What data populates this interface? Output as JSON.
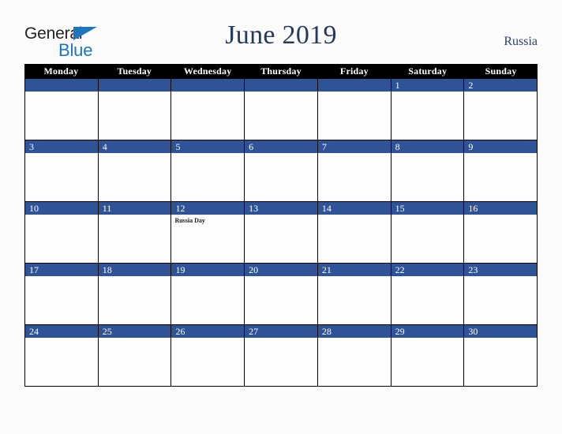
{
  "brand": {
    "word_one": "General",
    "word_two": "Blue",
    "triangle_icon": "triangle-icon",
    "dark_color": "#231f20",
    "blue_color": "#1e76bd"
  },
  "header": {
    "title": "June 2019",
    "country": "Russia",
    "title_color": "#27385e"
  },
  "theme": {
    "accent_blue": "#2e5396",
    "header_black": "#000000",
    "page_background": "#fcfcfd",
    "cell_background": "#fdfdfe"
  },
  "weekdays": [
    "Monday",
    "Tuesday",
    "Wednesday",
    "Thursday",
    "Friday",
    "Saturday",
    "Sunday"
  ],
  "weeks": [
    [
      {
        "day": "",
        "event": ""
      },
      {
        "day": "",
        "event": ""
      },
      {
        "day": "",
        "event": ""
      },
      {
        "day": "",
        "event": ""
      },
      {
        "day": "",
        "event": ""
      },
      {
        "day": "1",
        "event": ""
      },
      {
        "day": "2",
        "event": ""
      }
    ],
    [
      {
        "day": "3",
        "event": ""
      },
      {
        "day": "4",
        "event": ""
      },
      {
        "day": "5",
        "event": ""
      },
      {
        "day": "6",
        "event": ""
      },
      {
        "day": "7",
        "event": ""
      },
      {
        "day": "8",
        "event": ""
      },
      {
        "day": "9",
        "event": ""
      }
    ],
    [
      {
        "day": "10",
        "event": ""
      },
      {
        "day": "11",
        "event": ""
      },
      {
        "day": "12",
        "event": "Russia Day"
      },
      {
        "day": "13",
        "event": ""
      },
      {
        "day": "14",
        "event": ""
      },
      {
        "day": "15",
        "event": ""
      },
      {
        "day": "16",
        "event": ""
      }
    ],
    [
      {
        "day": "17",
        "event": ""
      },
      {
        "day": "18",
        "event": ""
      },
      {
        "day": "19",
        "event": ""
      },
      {
        "day": "20",
        "event": ""
      },
      {
        "day": "21",
        "event": ""
      },
      {
        "day": "22",
        "event": ""
      },
      {
        "day": "23",
        "event": ""
      }
    ],
    [
      {
        "day": "24",
        "event": ""
      },
      {
        "day": "25",
        "event": ""
      },
      {
        "day": "26",
        "event": ""
      },
      {
        "day": "27",
        "event": ""
      },
      {
        "day": "28",
        "event": ""
      },
      {
        "day": "29",
        "event": ""
      },
      {
        "day": "30",
        "event": ""
      }
    ]
  ]
}
